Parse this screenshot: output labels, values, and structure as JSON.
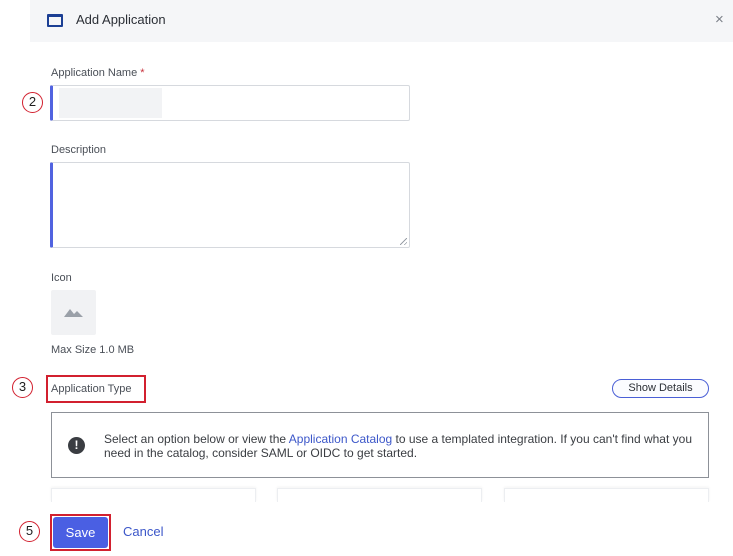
{
  "dialog": {
    "title": "Add Application",
    "close_glyph": "×"
  },
  "form": {
    "application_name": {
      "label": "Application Name",
      "required_mark": "*",
      "value": ""
    },
    "description": {
      "label": "Description",
      "value": ""
    },
    "icon": {
      "label": "Icon",
      "max_size": "Max Size 1.0 MB"
    },
    "application_type": {
      "label": "Application Type",
      "show_details": "Show Details"
    }
  },
  "info": {
    "icon_glyph": "!",
    "text_before": "Select an option below or view the ",
    "link": "Application Catalog",
    "text_after": " to use a templated integration. If you can't find what you need in the catalog, consider SAML or OIDC to get started."
  },
  "footer": {
    "save_label": "Save",
    "cancel_label": "Cancel"
  },
  "annotations": {
    "step_name": "2",
    "step_type": "3",
    "step_save": "5"
  },
  "colors": {
    "accent": "#4a5fe3",
    "link": "#3c57c9",
    "annotation_red": "#d2202f"
  }
}
